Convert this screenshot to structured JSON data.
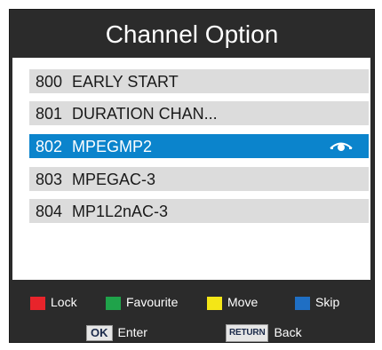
{
  "title": "Channel Option",
  "channels": [
    {
      "number": "800",
      "name": "EARLY START"
    },
    {
      "number": "801",
      "name": "DURATION CHAN..."
    },
    {
      "number": "802",
      "name": "MPEGMP2"
    },
    {
      "number": "803",
      "name": "MPEGAC-3"
    },
    {
      "number": "804",
      "name": "MP1L2nAC-3"
    }
  ],
  "selected_index": 2,
  "selected_icon": "eye-icon",
  "color_keys": {
    "lock": {
      "label": "Lock",
      "color": "#e8242b"
    },
    "favourite": {
      "label": "Favourite",
      "color": "#1fa34a"
    },
    "move": {
      "label": "Move",
      "color": "#f4e617"
    },
    "skip": {
      "label": "Skip",
      "color": "#1f6fc4"
    }
  },
  "buttons": {
    "ok": {
      "key": "OK",
      "label": "Enter"
    },
    "return": {
      "key": "RETURN",
      "label": "Back"
    }
  },
  "colors": {
    "panel": "#2b2b2b",
    "row": "#dcdcdc",
    "highlight": "#0b84cc"
  }
}
